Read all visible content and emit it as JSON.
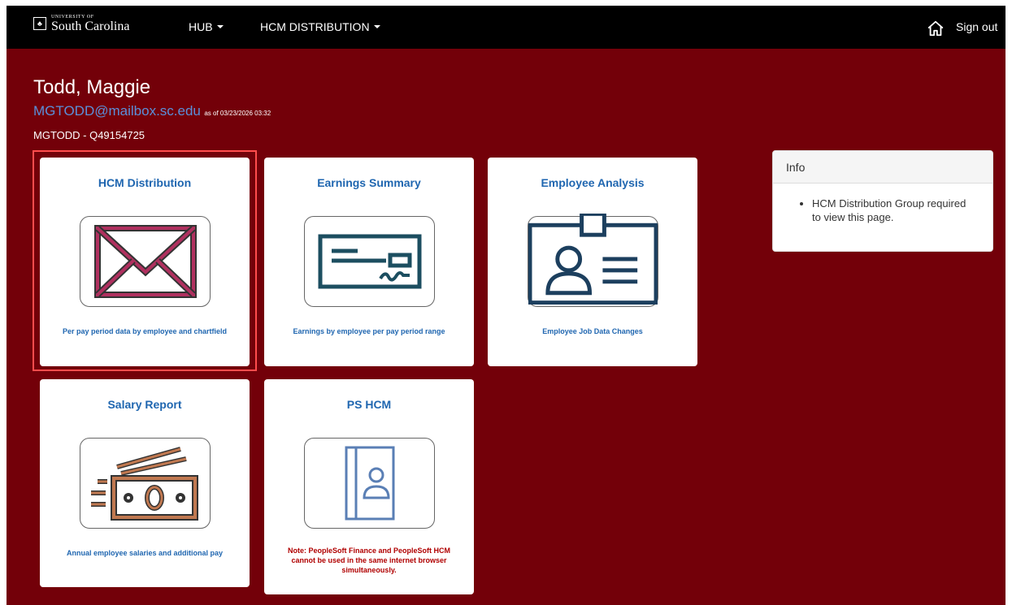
{
  "navbar": {
    "brand": {
      "university_of": "UNIVERSITY OF",
      "name": "South Carolina",
      "seal_glyph": "♣"
    },
    "menu": [
      {
        "label": "HUB"
      },
      {
        "label": "HCM DISTRIBUTION"
      }
    ],
    "home_icon": "home-icon",
    "sign_out": "Sign out"
  },
  "user": {
    "name": "Todd, Maggie",
    "email": "MGTODD@mailbox.sc.edu",
    "as_of": "as of 03/23/2026 03:32",
    "id_line": "MGTODD - Q49154725"
  },
  "tiles": [
    {
      "title": "HCM Distribution",
      "icon": "envelope-icon",
      "description": "Per pay period data by employee and chartfield",
      "selected": true
    },
    {
      "title": "Earnings Summary",
      "icon": "check-icon",
      "description": "Earnings by employee per pay period range"
    },
    {
      "title": "Employee Analysis",
      "icon": "id-badge-icon",
      "description": "Employee Job Data Changes"
    },
    {
      "title": "Salary Report",
      "icon": "money-icon",
      "description": "Annual employee salaries and additional pay"
    },
    {
      "title": "PS HCM",
      "icon": "address-book-icon",
      "note": "Note: PeopleSoft Finance and PeopleSoft HCM cannot be used in the same internet browser simultaneously."
    }
  ],
  "info": {
    "title": "Info",
    "items": [
      "HCM Distribution Group required to view this page."
    ]
  },
  "colors": {
    "navbar": "#000000",
    "background": "#730009",
    "accent_blue": "#1f66b0",
    "email_blue": "#5b8fd9",
    "selected_border": "#ff4d4d",
    "note_red": "#b00000"
  }
}
